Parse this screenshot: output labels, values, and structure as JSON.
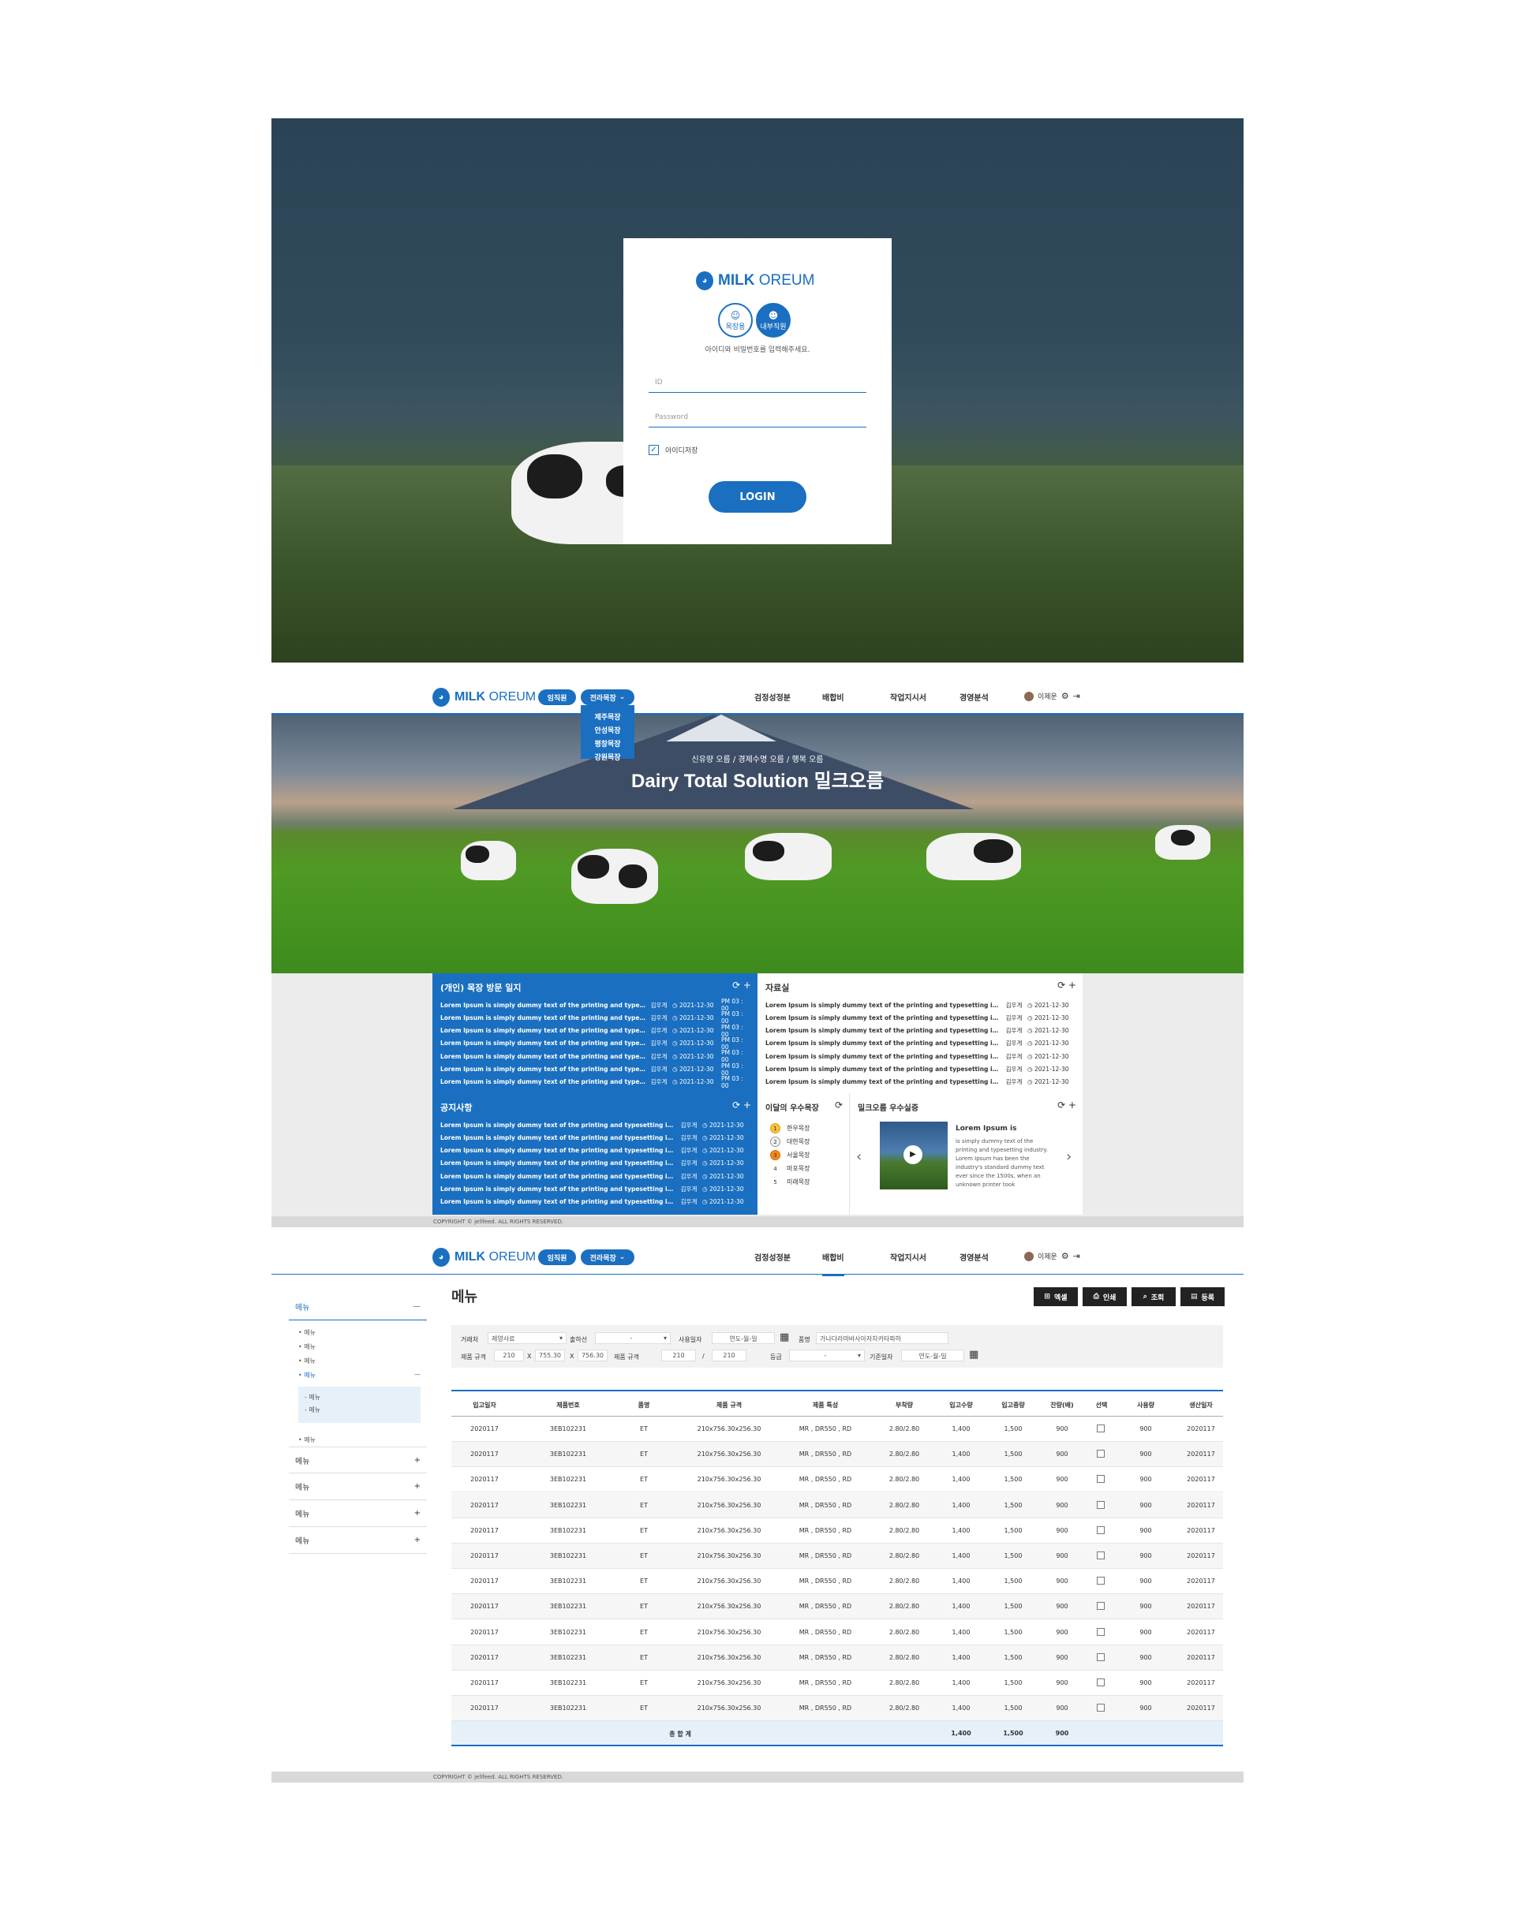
{
  "brand": {
    "milk": "MILK",
    "oreum": "OREUM",
    "drop_glyph": "◕"
  },
  "login": {
    "role_farm": "목장용",
    "role_staff": "내부직원",
    "instruction": "아이디와 비밀번호를 입력해주세요.",
    "id_placeholder": "ID",
    "password_placeholder": "Password",
    "remember_label": "아이디저장",
    "button": "LOGIN"
  },
  "nav": {
    "role_pill": "임직원",
    "farm_pill": "전라목장",
    "items": [
      "검정성정분",
      "배합비",
      "작업지시서",
      "경영분석"
    ],
    "user_name": "이제운",
    "farm_menu": [
      "제주목장",
      "안성목장",
      "평창목장",
      "강원목장"
    ]
  },
  "hero": {
    "subtitle": "신유량 오름 / 경제수명 오름 / 행복 오름",
    "title": "Dairy Total Solution 밀크오름"
  },
  "boards": {
    "visit_log": {
      "title": "(개인) 목장 방문 일지",
      "rows": [
        {
          "text": "Lorem Ipsum is simply dummy text of the printing and typesettin...",
          "author": "김우게",
          "date": "2021-12-30",
          "time": "PM 03 : 00"
        },
        {
          "text": "Lorem Ipsum is simply dummy text of the printing and typesettin...",
          "author": "김우게",
          "date": "2021-12-30",
          "time": "PM 03 : 00"
        },
        {
          "text": "Lorem Ipsum is simply dummy text of the printing and typesettin...",
          "author": "김우게",
          "date": "2021-12-30",
          "time": "PM 03 : 00"
        },
        {
          "text": "Lorem Ipsum is simply dummy text of the printing and typesettin...",
          "author": "김우게",
          "date": "2021-12-30",
          "time": "PM 03 : 00"
        },
        {
          "text": "Lorem Ipsum is simply dummy text of the printing and typesettin...",
          "author": "김우게",
          "date": "2021-12-30",
          "time": "PM 03 : 00"
        },
        {
          "text": "Lorem Ipsum is simply dummy text of the printing and typesettin...",
          "author": "김우게",
          "date": "2021-12-30",
          "time": "PM 03 : 00"
        },
        {
          "text": "Lorem Ipsum is simply dummy text of the printing and typesettin...",
          "author": "김우게",
          "date": "2021-12-30",
          "time": "PM 03 : 00"
        }
      ]
    },
    "archive": {
      "title": "자료실",
      "rows": [
        {
          "text": "Lorem Ipsum is simply dummy text of the printing and typesetting industry ha...",
          "author": "김우게",
          "date": "2021-12-30"
        },
        {
          "text": "Lorem Ipsum is simply dummy text of the printing and typesetting industry ha...",
          "author": "김우게",
          "date": "2021-12-30"
        },
        {
          "text": "Lorem Ipsum is simply dummy text of the printing and typesetting industry ha...",
          "author": "김우게",
          "date": "2021-12-30"
        },
        {
          "text": "Lorem Ipsum is simply dummy text of the printing and typesetting industry ha...",
          "author": "김우게",
          "date": "2021-12-30"
        },
        {
          "text": "Lorem Ipsum is simply dummy text of the printing and typesetting industry ha...",
          "author": "김우게",
          "date": "2021-12-30"
        },
        {
          "text": "Lorem Ipsum is simply dummy text of the printing and typesetting industry ha...",
          "author": "김우게",
          "date": "2021-12-30"
        },
        {
          "text": "Lorem Ipsum is simply dummy text of the printing and typesetting industry ha...",
          "author": "김우게",
          "date": "2021-12-30"
        }
      ]
    },
    "notice": {
      "title": "공지사항",
      "rows": [
        {
          "text": "Lorem Ipsum is simply dummy text of the printing and typesetting industry ha...",
          "author": "김우게",
          "date": "2021-12-30"
        },
        {
          "text": "Lorem Ipsum is simply dummy text of the printing and typesetting industry ha...",
          "author": "김우게",
          "date": "2021-12-30"
        },
        {
          "text": "Lorem Ipsum is simply dummy text of the printing and typesetting industry ha...",
          "author": "김우게",
          "date": "2021-12-30"
        },
        {
          "text": "Lorem Ipsum is simply dummy text of the printing and typesetting industry ha...",
          "author": "김우게",
          "date": "2021-12-30"
        },
        {
          "text": "Lorem Ipsum is simply dummy text of the printing and typesetting industry ha...",
          "author": "김우게",
          "date": "2021-12-30"
        },
        {
          "text": "Lorem Ipsum is simply dummy text of the printing and typesetting industry ha...",
          "author": "김우게",
          "date": "2021-12-30"
        },
        {
          "text": "Lorem Ipsum is simply dummy text of the printing and typesetting industry ha...",
          "author": "김우게",
          "date": "2021-12-30"
        }
      ]
    },
    "best_farm": {
      "title": "이달의 우수목장",
      "ranks": [
        {
          "no": "1",
          "name": "한우목장"
        },
        {
          "no": "2",
          "name": "대한목장"
        },
        {
          "no": "3",
          "name": "서울목장"
        },
        {
          "no": "4",
          "name": "마포목장"
        },
        {
          "no": "5",
          "name": "미래목장"
        }
      ]
    },
    "case": {
      "title": "밀크오름 우수실증",
      "card_title": "Lorem Ipsum is",
      "card_text": "is simply dummy text of the printing and typesetting industry. Lorem Ipsum has been the industry's standard dummy text ever since the 1500s, when an unknown printer took"
    }
  },
  "footer": "COPYRIGHT © jellfeed. ALL RIGHTS RESERVED.",
  "page3": {
    "active_nav": "배합비",
    "title": "메뉴",
    "buttons": [
      "엑셀",
      "인쇄",
      "조회",
      "등록"
    ],
    "sidebar": {
      "top": "메뉴",
      "subs": [
        "• 메뉴",
        "• 메뉴",
        "• 메뉴"
      ],
      "active": "• 메뉴",
      "subsubs": [
        "- 메뉴",
        "- 메뉴"
      ],
      "after": "• 메뉴",
      "groups": [
        "메뉴",
        "메뉴",
        "메뉴",
        "메뉴"
      ]
    },
    "filter": {
      "row1": [
        {
          "label": "거래처",
          "value": "제영사료"
        },
        {
          "label": "출하선",
          "value": "-"
        },
        {
          "label": "사용일자",
          "value": "연도-월-일"
        },
        {
          "label": "품명",
          "value": "가나다라마바사아자차카타파하"
        }
      ],
      "row2": [
        {
          "label": "제품 규격",
          "v1": "210",
          "x1": "X",
          "v2": "755.30",
          "x2": "X",
          "v3": "756.30"
        },
        {
          "label": "제품 규격",
          "v1": "210",
          "sep": "/",
          "v2": "210"
        },
        {
          "label": "등급",
          "value": "-"
        },
        {
          "label": "기준일자",
          "value": "연도-월-일"
        }
      ]
    },
    "columns": [
      "입고일자",
      "제품번호",
      "품명",
      "제품 규격",
      "제품 특성",
      "부착량",
      "입고수량",
      "입고중량",
      "잔량(배)",
      "선택",
      "사용량",
      "생산일자"
    ],
    "row": [
      "2020117",
      "3EB102231",
      "ET",
      "210x756.30x256.30",
      "MR , DR550 , RD",
      "2.80/2.80",
      "1,400",
      "1,500",
      "900",
      "",
      "900",
      "2020117"
    ],
    "row_count": 12,
    "total": {
      "label": "총 합 계",
      "qty": "1,400",
      "weight": "1,500",
      "remain": "900"
    }
  }
}
